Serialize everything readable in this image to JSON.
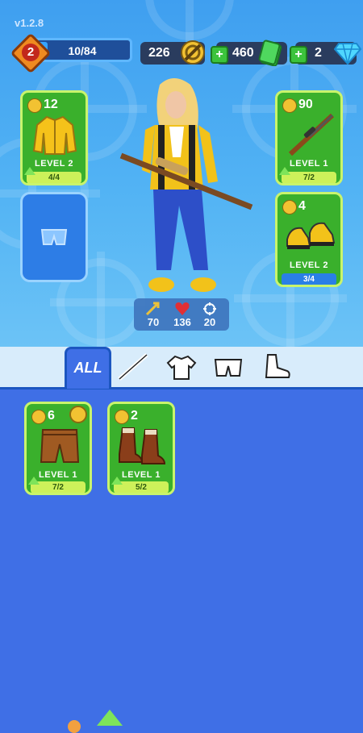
{
  "version": "v1.2.8",
  "player": {
    "level": "2",
    "xp": "10/84"
  },
  "resources": {
    "bolts": "226",
    "cash": "460",
    "gems": "2"
  },
  "equipped": {
    "jacket": {
      "count": "12",
      "level": "LEVEL 2",
      "progress": "4/4"
    },
    "rifle": {
      "count": "90",
      "level": "LEVEL 1",
      "progress": "7/2"
    },
    "shoes": {
      "count": "4",
      "level": "LEVEL 2",
      "progress": "3/4"
    }
  },
  "stats": {
    "power": "70",
    "health": "136",
    "accuracy": "20"
  },
  "tabs": {
    "all_label": "ALL"
  },
  "inventory": [
    {
      "name": "shorts",
      "count": "6",
      "level": "LEVEL 1",
      "progress": "7/2"
    },
    {
      "name": "boots",
      "count": "2",
      "level": "LEVEL 1",
      "progress": "5/2"
    }
  ],
  "colors": {
    "card_green": "#3ab02c",
    "progress_lime": "#cdf15a",
    "sky_blue": "#52b3f4",
    "panel_blue": "#3f6fe6"
  }
}
